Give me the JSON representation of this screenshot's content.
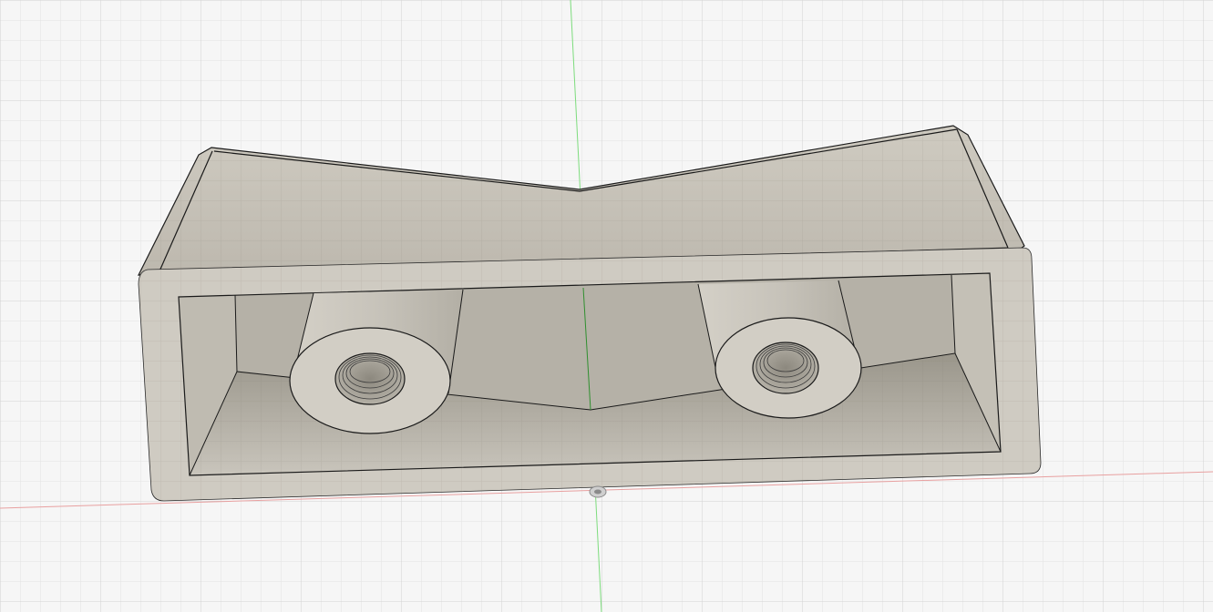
{
  "viewport": {
    "background": "#f6f6f6",
    "grid_minor_color": "#e3e3e3",
    "grid_major_color": "#cfcfcf",
    "axis_y_color": "#7ddc7d",
    "axis_x_color": "#e8a0a0"
  },
  "model": {
    "body_color": "#c9c5bc",
    "top_face_color": "#c5c1b7",
    "front_rim_color": "#cfcbc2",
    "cavity_color": "#a9a599",
    "edge_color": "#1a1a1a",
    "bosses": [
      {
        "name": "left-threaded-boss"
      },
      {
        "name": "right-threaded-boss"
      }
    ]
  },
  "origin_marker": {
    "icon": "origin-marker-icon"
  }
}
